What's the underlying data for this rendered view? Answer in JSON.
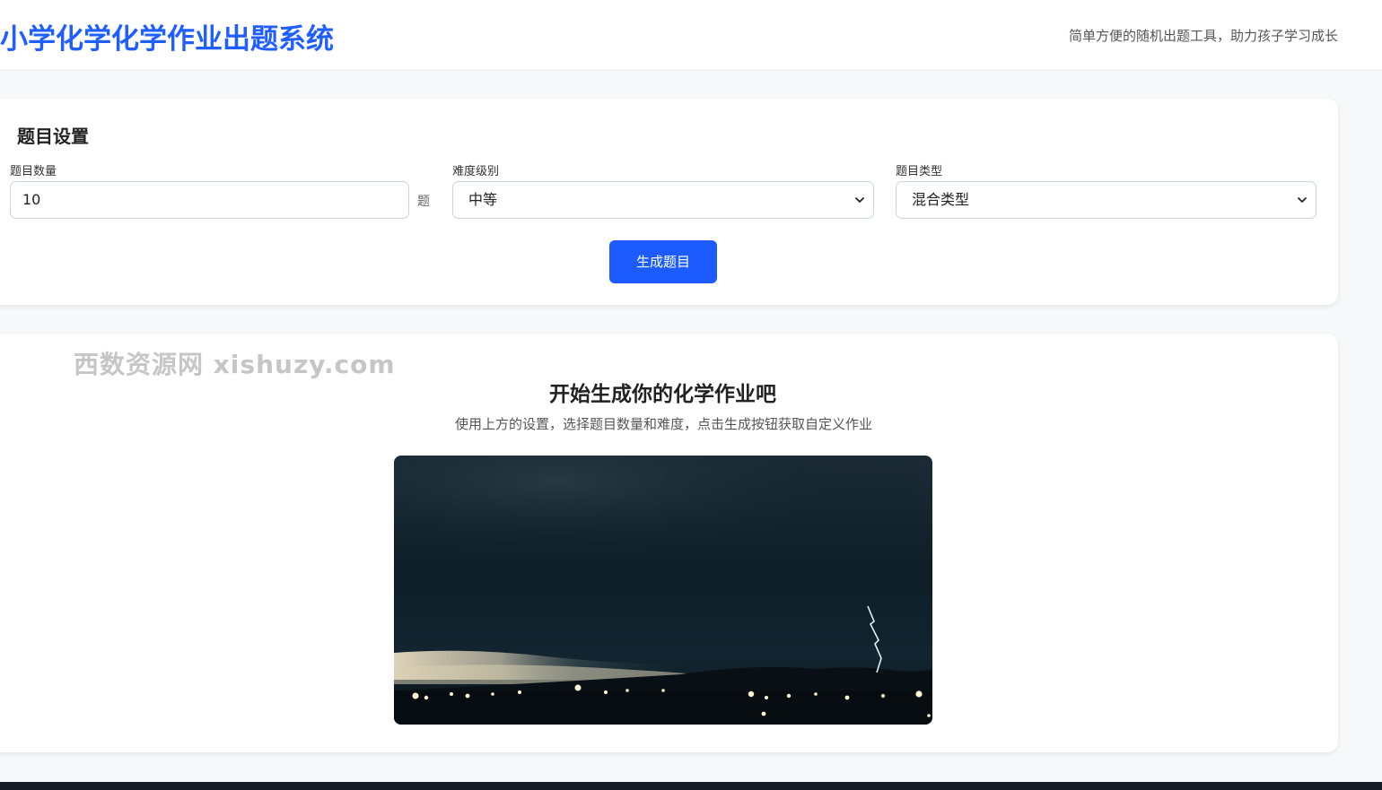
{
  "header": {
    "title": "小学化学化学作业出题系统",
    "subtitle": "简单方便的随机出题工具，助力孩子学习成长"
  },
  "settings": {
    "title": "题目设置",
    "count_label": "题目数量",
    "count_value": "10",
    "count_unit": "题",
    "difficulty_label": "难度级别",
    "difficulty_value": "中等",
    "type_label": "题目类型",
    "type_value": "混合类型",
    "generate_label": "生成题目"
  },
  "result": {
    "watermark": "西数资源网  xishuzy.com",
    "heading": "开始生成你的化学作业吧",
    "description": "使用上方的设置，选择题目数量和难度，点击生成按钮获取自定义作业"
  },
  "colors": {
    "brand": "#1f5eff",
    "button": "#1c5cff",
    "background": "#f7f8fa",
    "footer": "#151a23"
  },
  "icons": {
    "select_arrow": "chevron-down-icon"
  }
}
